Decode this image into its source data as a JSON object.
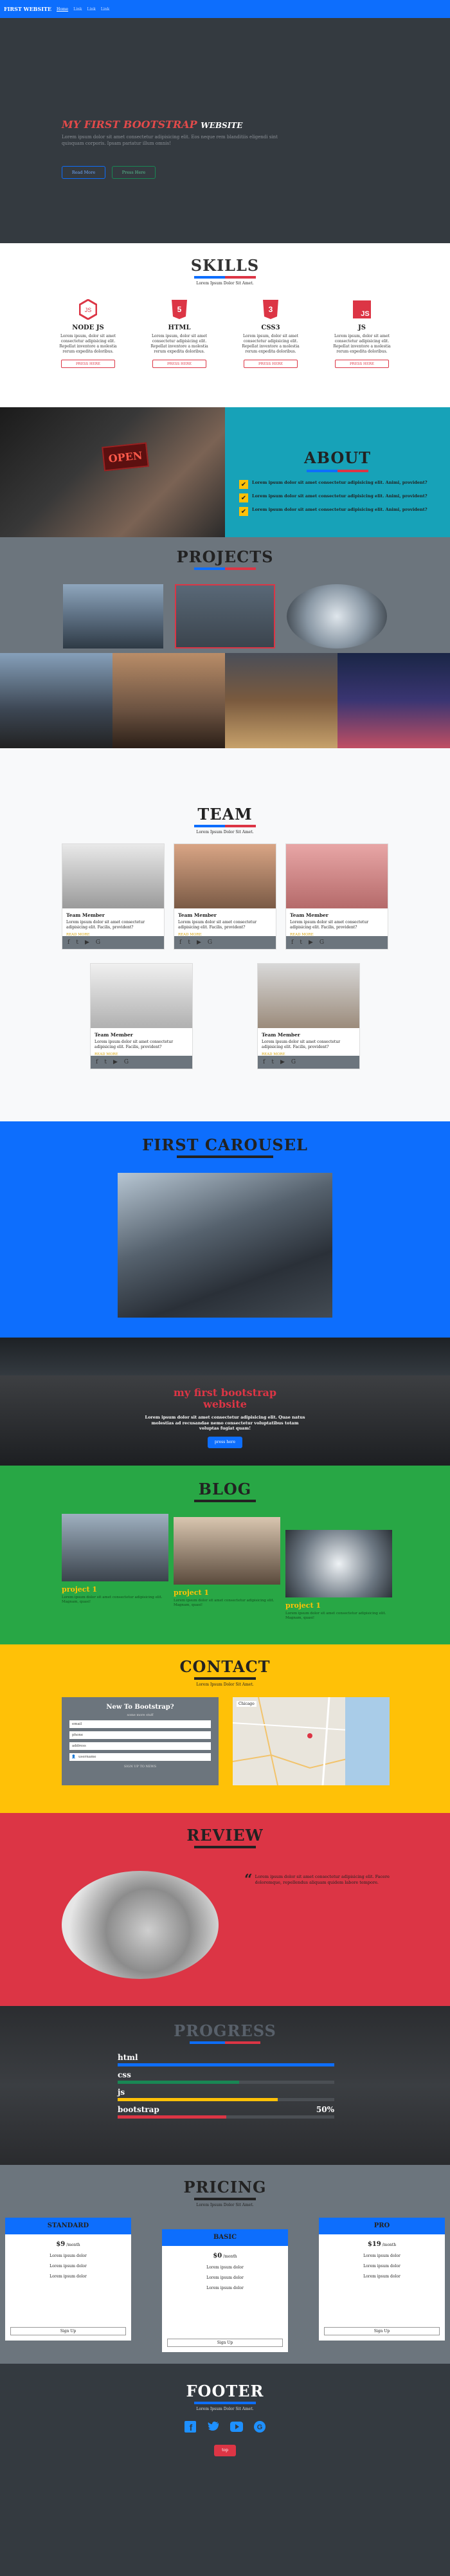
{
  "nav": {
    "brand": "FIRST WEBSITE",
    "items": [
      "Home",
      "Link",
      "Link",
      "Link"
    ]
  },
  "hero": {
    "title_red": "MY FIRST BOOTSTRAP",
    "title_white": "WEBSITE",
    "text": "Lorem ipsum dolor sit amet consectetur adipisicing elit. Eos neque rem blanditiis eligendi sint quisquam corporis. Ipsam pariatur illum omnis!",
    "btn_primary": "Read More",
    "btn_secondary": "Press Here"
  },
  "skills": {
    "title": "SKILLS",
    "subtitle": "Lorem Ipsum Dolor Sit Amet.",
    "items": [
      {
        "name": "NODE JS",
        "icon": "nodejs-icon",
        "color": "#dc3545",
        "text": "Lorem ipsum, dolor sit amet consectetur adipisicing elit. Repellat inventore a molestia rerum expedita doloribus.",
        "btn": "PRESS HERE"
      },
      {
        "name": "HTML",
        "icon": "html5-icon",
        "color": "#dc3545",
        "text": "Lorem ipsum, dolor sit amet consectetur adipisicing elit. Repellat inventore a molestia rerum expedita doloribus.",
        "btn": "PRESS HERE"
      },
      {
        "name": "CSS3",
        "icon": "css3-icon",
        "color": "#dc3545",
        "text": "Lorem ipsum, dolor sit amet consectetur adipisicing elit. Repellat inventore a molestia rerum expedita doloribus.",
        "btn": "PRESS HERE"
      },
      {
        "name": "JS",
        "icon": "js-icon",
        "color": "#dc3545",
        "text": "Lorem ipsum, dolor sit amet consectetur adipisicing elit. Repellat inventore a molestia rerum expedita doloribus.",
        "btn": "PRESS HERE"
      }
    ]
  },
  "about": {
    "title": "ABOUT",
    "sign_text": "OPEN",
    "items": [
      "Lorem ipsum dolor sit amet consectetur adipisicing elit. Animi, provident?",
      "Lorem ipsum dolor sit amet consectetur adipisicing elit. Animi, provident?",
      "Lorem ipsum dolor sit amet consectetur adipisicing elit. Animi, provident?"
    ]
  },
  "projects": {
    "title": "PROJECTS"
  },
  "team": {
    "title": "TEAM",
    "subtitle": "Lorem Ipsum Dolor Sit Amet.",
    "members": [
      {
        "name": "Team Member",
        "text": "Lorem ipsum dolor sit amet consectetur adipisicing elit. Facilis, provident?",
        "link": "READ MORE"
      },
      {
        "name": "Team Member",
        "text": "Lorem ipsum dolor sit amet consectetur adipisicing elit. Facilis, provident?",
        "link": "READ MORE"
      },
      {
        "name": "Team Member",
        "text": "Lorem ipsum dolor sit amet consectetur adipisicing elit. Facilis, provident?",
        "link": "READ MORE"
      },
      {
        "name": "Team Member",
        "text": "Lorem ipsum dolor sit amet consectetur adipisicing elit. Facilis, provident?",
        "link": "READ MORE"
      },
      {
        "name": "Team Member",
        "text": "Lorem ipsum dolor sit amet consectetur adipisicing elit. Facilis, provident?",
        "link": "READ MORE"
      }
    ]
  },
  "carousel": {
    "title": "FIRST CAROUSEL"
  },
  "hero2": {
    "title_line1": "my first bootstrap",
    "title_line2": "website",
    "text": "Lorem ipsum dolor sit amet consectetur adipisicing elit. Quae natus molestias ad recusandae nemo consectetur voluptatibus totam voluptas fugiat quam!",
    "btn": "press here"
  },
  "blog": {
    "title": "BLOG",
    "posts": [
      {
        "title": "project 1",
        "text": "Lorem ipsum dolor sit amet consectetur adipisicing elit. Magnam, quasi!"
      },
      {
        "title": "project 1",
        "text": "Lorem ipsum dolor sit amet consectetur adipisicing elit. Magnam, quasi!"
      },
      {
        "title": "project 1",
        "text": "Lorem ipsum dolor sit amet consectetur adipisicing elit. Magnam, quasi!"
      }
    ]
  },
  "contact": {
    "title": "CONTACT",
    "subtitle": "Lorem Ipsum Dolor Sit Amet.",
    "form_title": "New To Bootstrap?",
    "form_subtitle": "some more stuff",
    "fields": [
      "email",
      "phone",
      "address"
    ],
    "last_field": "username",
    "submit": "SIGN UP TO NEWS",
    "map_label": "Chicago"
  },
  "review": {
    "title": "REVIEW",
    "quote": "Lorem ipsum dolor sit amet consectetur adipisicing elit. Facere doloremque, repellendus aliquam quidem labore tempore."
  },
  "progress": {
    "title": "PROGRESS",
    "bars": [
      {
        "label": "html",
        "value": "",
        "percent": 100,
        "color": "#0d6efd"
      },
      {
        "label": "css",
        "value": "",
        "percent": 56,
        "color": "#198754"
      },
      {
        "label": "js",
        "value": "",
        "percent": 74,
        "color": "#ffc107"
      },
      {
        "label": "bootstrap",
        "value": "50%",
        "percent": 50,
        "color": "#dc3545"
      }
    ]
  },
  "pricing": {
    "title": "PRICING",
    "subtitle": "Lorem Ipsum Dolor Sit Amet.",
    "plans": [
      {
        "name": "STANDARD",
        "price": "$9",
        "per": "/month",
        "features": [
          "Lorem ipsum dolor",
          "Lorem ipsum dolor",
          "Lorem ipsum dolor"
        ],
        "btn": "Sign Up"
      },
      {
        "name": "BASIC",
        "price": "$0",
        "per": "/month",
        "features": [
          "Lorem ipsum dolor",
          "Lorem ipsum dolor",
          "Lorem ipsum dolor"
        ],
        "btn": "Sign Up"
      },
      {
        "name": "PRO",
        "price": "$19",
        "per": "/month",
        "features": [
          "Lorem ipsum dolor",
          "Lorem ipsum dolor",
          "Lorem ipsum dolor"
        ],
        "btn": "Sign Up"
      }
    ]
  },
  "footer": {
    "title": "FOOTER",
    "subtitle": "Lorem Ipsum Dolor Sit Amet.",
    "socials": [
      "facebook-icon",
      "twitter-icon",
      "youtube-icon",
      "google-icon"
    ],
    "btn": "top"
  }
}
